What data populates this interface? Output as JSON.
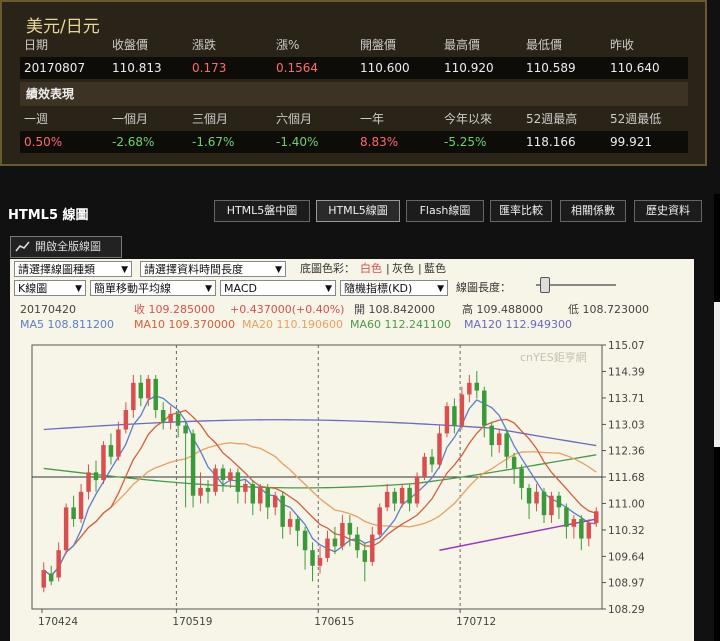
{
  "quote": {
    "title": "美元/日元",
    "headers": [
      "日期",
      "收盤價",
      "漲跌",
      "漲%",
      "開盤價",
      "最高價",
      "最低價",
      "昨收"
    ],
    "values": [
      "20170807",
      "110.813",
      "0.173",
      "0.1564",
      "110.600",
      "110.920",
      "110.589",
      "110.640"
    ],
    "perf_title": "績效表現",
    "perf_headers": [
      "一週",
      "一個月",
      "三個月",
      "六個月",
      "一年",
      "今年以來",
      "52週最高",
      "52週最低"
    ],
    "perf_values": [
      "0.50%",
      "-2.68%",
      "-1.67%",
      "-1.40%",
      "8.83%",
      "-5.25%",
      "118.166",
      "99.921"
    ]
  },
  "panel": {
    "title": "HTML5 線圖",
    "tabs": [
      "HTML5盤中圖",
      "HTML5線圖",
      "Flash線圖",
      "匯率比較",
      "相關係數",
      "歷史資料"
    ],
    "open_button": "開啟全版線圖"
  },
  "controls": {
    "chart_type": "請選擇線圖種類",
    "time_length": "請選擇資料時間長度",
    "bg_label": "底圖色彩：",
    "colors": [
      "白色",
      "灰色",
      "藍色"
    ],
    "sep": "|",
    "kline": "K線圖",
    "ma": "簡單移動平均線",
    "macd": "MACD",
    "kd": "隨機指標(KD)",
    "length_label": "線圖長度："
  },
  "info": {
    "date": "20170420",
    "close": "收 109.285000",
    "change": "+0.437000(+0.40%)",
    "open": "開 108.842000",
    "high": "高 109.488000",
    "low": "低 108.723000",
    "ma5": "MA5 108.811200",
    "ma10": "MA10 109.370000",
    "ma20": "MA20 110.190600",
    "ma60": "MA60 112.241100",
    "ma120": "MA120 112.949300"
  },
  "watermark": "cnYES鉅亨網",
  "colors": {
    "up": "#d94f4f",
    "down": "#3a9a3a",
    "ma5": "#5a7fc8",
    "ma10": "#d0603a",
    "ma20": "#e8a060",
    "ma60": "#4a9a4a",
    "ma120": "#6a6ac0",
    "trend": "#9a3ab8"
  },
  "chart_data": {
    "type": "candlestick",
    "x_ticks": [
      "170424",
      "170519",
      "170615",
      "170712"
    ],
    "y_ticks": [
      "115.07",
      "114.39",
      "113.71",
      "113.03",
      "112.36",
      "111.68",
      "111.00",
      "110.32",
      "109.64",
      "108.97",
      "108.29"
    ],
    "ylim": [
      108.29,
      115.07
    ],
    "ref_line": 111.68,
    "candles": [
      [
        108.84,
        109.29,
        109.49,
        108.72
      ],
      [
        109.2,
        109.0,
        109.4,
        108.9
      ],
      [
        109.1,
        109.8,
        110.0,
        109.0
      ],
      [
        109.8,
        110.9,
        111.0,
        109.7
      ],
      [
        110.9,
        110.6,
        111.2,
        110.4
      ],
      [
        110.6,
        111.3,
        111.5,
        110.5
      ],
      [
        111.3,
        111.8,
        112.0,
        111.1
      ],
      [
        111.8,
        111.6,
        112.1,
        111.3
      ],
      [
        111.6,
        112.5,
        112.6,
        111.5
      ],
      [
        112.5,
        112.2,
        112.8,
        112.0
      ],
      [
        112.2,
        112.9,
        113.1,
        112.1
      ],
      [
        112.9,
        113.4,
        113.6,
        112.8
      ],
      [
        113.4,
        114.1,
        114.3,
        113.2
      ],
      [
        114.1,
        113.7,
        114.3,
        113.5
      ],
      [
        113.7,
        114.2,
        114.3,
        113.5
      ],
      [
        114.2,
        113.4,
        114.3,
        113.2
      ],
      [
        113.4,
        113.1,
        113.6,
        112.9
      ],
      [
        113.1,
        113.3,
        113.5,
        112.9
      ],
      [
        113.3,
        113.0,
        113.4,
        112.7
      ],
      [
        113.0,
        112.8,
        113.1,
        110.9
      ],
      [
        112.8,
        111.2,
        112.9,
        110.9
      ],
      [
        111.2,
        111.4,
        111.8,
        111.0
      ],
      [
        111.4,
        111.3,
        111.6,
        111.0
      ],
      [
        111.3,
        111.9,
        112.0,
        111.2
      ],
      [
        111.9,
        111.6,
        112.0,
        111.3
      ],
      [
        111.6,
        111.8,
        111.9,
        111.4
      ],
      [
        111.8,
        111.3,
        111.9,
        111.0
      ],
      [
        111.3,
        111.5,
        111.6,
        111.0
      ],
      [
        111.5,
        111.0,
        111.6,
        110.7
      ],
      [
        111.0,
        111.4,
        111.5,
        110.8
      ],
      [
        111.4,
        110.9,
        111.5,
        110.6
      ],
      [
        110.9,
        111.2,
        111.3,
        110.7
      ],
      [
        111.2,
        110.4,
        111.3,
        110.1
      ],
      [
        110.4,
        110.6,
        110.8,
        110.2
      ],
      [
        110.6,
        110.3,
        110.7,
        109.9
      ],
      [
        110.3,
        109.8,
        110.4,
        109.3
      ],
      [
        109.8,
        109.4,
        110.0,
        109.0
      ],
      [
        109.4,
        109.6,
        109.9,
        109.2
      ],
      [
        109.6,
        110.1,
        110.3,
        109.5
      ],
      [
        110.1,
        109.9,
        110.4,
        109.7
      ],
      [
        109.9,
        110.5,
        110.7,
        109.8
      ],
      [
        110.5,
        110.2,
        110.7,
        109.9
      ],
      [
        110.2,
        109.8,
        110.4,
        109.6
      ],
      [
        109.8,
        109.5,
        110.0,
        109.0
      ],
      [
        109.5,
        110.2,
        110.4,
        109.4
      ],
      [
        110.2,
        110.9,
        111.0,
        110.1
      ],
      [
        110.9,
        111.3,
        111.5,
        110.8
      ],
      [
        111.3,
        111.0,
        111.4,
        110.8
      ],
      [
        111.0,
        111.4,
        111.5,
        110.9
      ],
      [
        111.4,
        111.0,
        111.5,
        110.8
      ],
      [
        111.0,
        111.7,
        111.8,
        110.9
      ],
      [
        111.7,
        112.2,
        112.3,
        111.6
      ],
      [
        112.2,
        112.0,
        112.4,
        111.8
      ],
      [
        112.0,
        112.8,
        113.0,
        111.9
      ],
      [
        112.8,
        113.5,
        113.6,
        112.7
      ],
      [
        113.5,
        113.0,
        113.7,
        112.8
      ],
      [
        113.0,
        113.8,
        114.0,
        112.9
      ],
      [
        113.8,
        114.1,
        114.3,
        113.6
      ],
      [
        114.1,
        113.9,
        114.4,
        113.7
      ],
      [
        113.9,
        113.0,
        114.0,
        112.7
      ],
      [
        113.0,
        112.5,
        113.1,
        112.2
      ],
      [
        112.5,
        112.8,
        112.9,
        112.3
      ],
      [
        112.8,
        112.2,
        112.9,
        111.9
      ],
      [
        112.2,
        111.9,
        112.3,
        111.5
      ],
      [
        111.9,
        111.4,
        112.0,
        111.1
      ],
      [
        111.4,
        111.0,
        111.5,
        110.6
      ],
      [
        111.0,
        111.3,
        111.5,
        110.8
      ],
      [
        111.3,
        110.7,
        111.4,
        110.5
      ],
      [
        110.7,
        111.2,
        111.3,
        110.5
      ],
      [
        111.2,
        110.9,
        111.3,
        110.6
      ],
      [
        110.9,
        110.4,
        111.0,
        110.1
      ],
      [
        110.4,
        110.6,
        110.7,
        110.1
      ],
      [
        110.6,
        110.1,
        110.7,
        109.8
      ],
      [
        110.1,
        110.5,
        110.6,
        109.9
      ],
      [
        110.5,
        110.8,
        110.9,
        110.4
      ]
    ]
  }
}
